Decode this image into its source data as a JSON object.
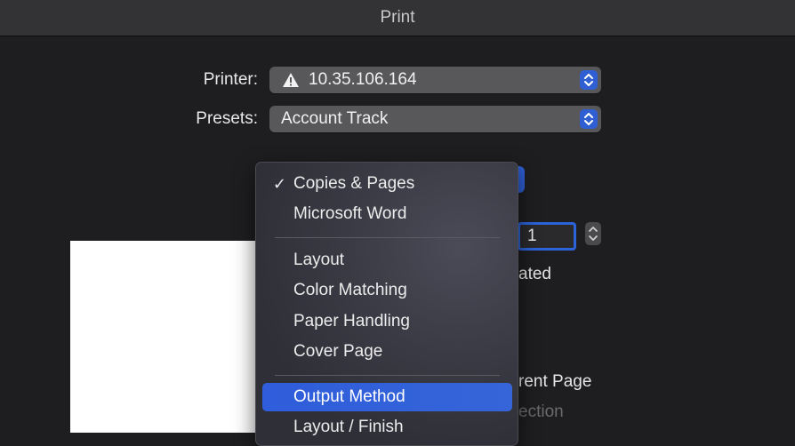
{
  "window": {
    "title": "Print"
  },
  "printer": {
    "label": "Printer:",
    "value": "10.35.106.164",
    "warning_icon": "warning-triangle-icon"
  },
  "presets": {
    "label": "Presets:",
    "value": "Account Track"
  },
  "copies": {
    "value": "1"
  },
  "background_fragments": {
    "collated": "ated",
    "current_page": "rent Page",
    "selection": "ection"
  },
  "menu": {
    "items": [
      {
        "label": "Copies & Pages",
        "checked": true,
        "check": "✓"
      },
      {
        "label": "Microsoft Word"
      },
      {
        "label": "Layout"
      },
      {
        "label": "Color Matching"
      },
      {
        "label": "Paper Handling"
      },
      {
        "label": "Cover Page"
      },
      {
        "label": "Output Method",
        "selected": true
      },
      {
        "label": "Layout / Finish"
      }
    ]
  },
  "colors": {
    "accent": "#2f5fd3",
    "selection": "#3565d8",
    "window_bg": "#1e1e21",
    "titlebar_bg": "#333336"
  }
}
